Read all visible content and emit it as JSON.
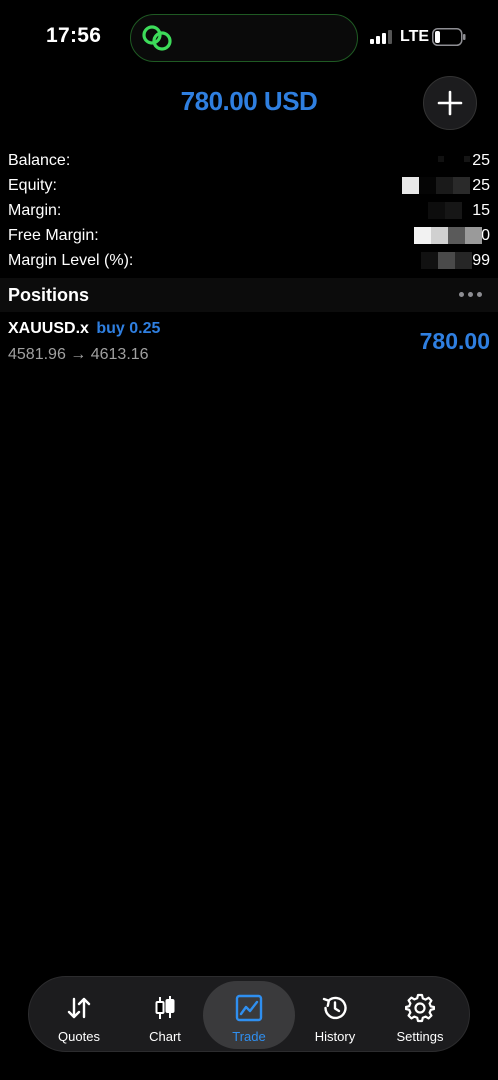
{
  "status_bar": {
    "time": "17:56",
    "network": "LTE"
  },
  "header": {
    "amount": "780.00 USD",
    "add_icon": "plus-icon"
  },
  "account": {
    "rows": [
      {
        "label": "Balance:",
        "value_visible": "25"
      },
      {
        "label": "Equity:",
        "value_visible": "25"
      },
      {
        "label": "Margin:",
        "value_visible": "15"
      },
      {
        "label": "Free Margin:",
        "value_visible": "0"
      },
      {
        "label": "Margin Level (%):",
        "value_visible": "99"
      }
    ]
  },
  "positions": {
    "title": "Positions",
    "items": [
      {
        "symbol": "XAUUSD.x",
        "side": "buy 0.25",
        "prices": "4581.96 → 4613.16",
        "profit": "780.00"
      }
    ]
  },
  "tabs": [
    {
      "label": "Quotes",
      "icon": "arrows-updown-icon",
      "active": false
    },
    {
      "label": "Chart",
      "icon": "candlestick-icon",
      "active": false
    },
    {
      "label": "Trade",
      "icon": "trend-chart-icon",
      "active": true
    },
    {
      "label": "History",
      "icon": "history-icon",
      "active": false
    },
    {
      "label": "Settings",
      "icon": "gear-icon",
      "active": false
    }
  ],
  "colors": {
    "accent": "#2f7fe0",
    "background": "#000000",
    "island_border": "#1f5a23",
    "link_icon": "#3ddc5a"
  }
}
